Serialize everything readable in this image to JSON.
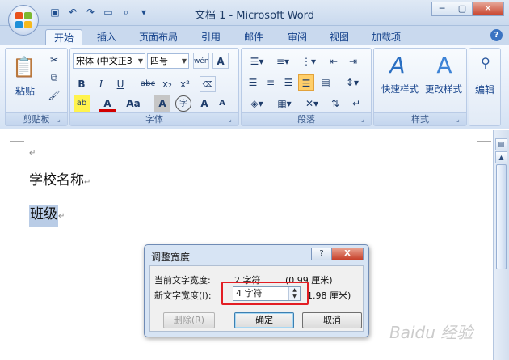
{
  "window": {
    "title": "文档 1 - Microsoft Word",
    "controls": {
      "minimize": "─",
      "maximize": "▢",
      "close": "✕"
    }
  },
  "quick_access": [
    "save-icon",
    "undo-icon",
    "redo-icon",
    "open-icon",
    "print-preview-icon"
  ],
  "tabs": [
    {
      "label": "开始",
      "active": true
    },
    {
      "label": "插入"
    },
    {
      "label": "页面布局"
    },
    {
      "label": "引用"
    },
    {
      "label": "邮件"
    },
    {
      "label": "审阅"
    },
    {
      "label": "视图"
    },
    {
      "label": "加载项"
    }
  ],
  "ribbon": {
    "clipboard": {
      "paste_label": "粘贴",
      "group_label": "剪贴板"
    },
    "font": {
      "font_name": "宋体 (中文正3",
      "font_size": "四号",
      "group_label": "字体",
      "bold": "B",
      "italic": "I",
      "underline": "U",
      "strike": "abc",
      "subscript": "x₂",
      "superscript": "x²",
      "grow": "A",
      "shrink": "A",
      "char_case": "Aa",
      "wen": "wén",
      "font_color": "A",
      "highlight": "ab",
      "shading": "A",
      "enclose": "字"
    },
    "paragraph": {
      "group_label": "段落"
    },
    "styles": {
      "quick_styles": "快速样式",
      "change_styles": "更改样式",
      "group_label": "样式"
    },
    "editing": {
      "label": "编辑"
    }
  },
  "document": {
    "line1": "学校名称",
    "line2": "班级"
  },
  "dialog": {
    "title": "调整宽度",
    "current_label": "当前文字宽度:",
    "current_value": "2 字符",
    "current_cm": "(0.99 厘米)",
    "new_label": "新文字宽度(I):",
    "new_value": "4 字符",
    "new_cm": "1.98 厘米)",
    "delete_button": "删除(R)",
    "ok_button": "确定",
    "cancel_button": "取消",
    "help": "?",
    "close": "X"
  },
  "watermark": "Baidu 经验",
  "colors": {
    "accent": "#15428b",
    "ribbon_bg": "#dce7f5",
    "selection": "#b9cce6",
    "highlight_box": "#e31e24"
  }
}
